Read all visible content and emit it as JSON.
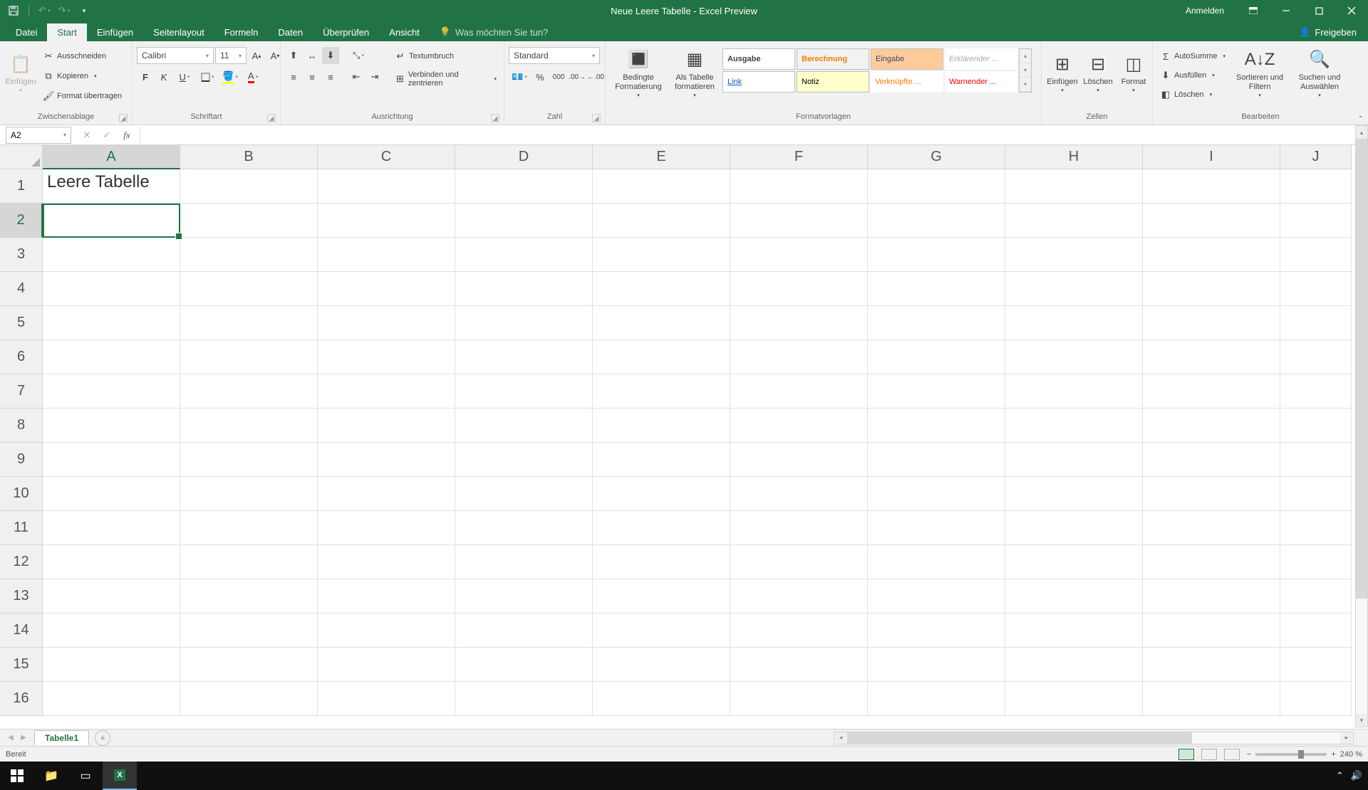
{
  "titlebar": {
    "title": "Neue Leere Tabelle  -  Excel Preview",
    "signin": "Anmelden"
  },
  "menu": {
    "tabs": [
      "Datei",
      "Start",
      "Einfügen",
      "Seitenlayout",
      "Formeln",
      "Daten",
      "Überprüfen",
      "Ansicht"
    ],
    "active": 1,
    "tellme": "Was möchten Sie tun?",
    "share": "Freigeben"
  },
  "ribbon": {
    "clipboard": {
      "paste": "Einfügen",
      "cut": "Ausschneiden",
      "copy": "Kopieren",
      "painter": "Format übertragen",
      "label": "Zwischenablage"
    },
    "font": {
      "name": "Calibri",
      "size": "11",
      "label": "Schriftart"
    },
    "align": {
      "wrap": "Textumbruch",
      "merge": "Verbinden und zentrieren",
      "label": "Ausrichtung"
    },
    "number": {
      "format": "Standard",
      "label": "Zahl"
    },
    "styles": {
      "cond": "Bedingte Formatierung",
      "astable": "Als Tabelle formatieren",
      "cells": [
        "Ausgabe",
        "Berechnung",
        "Eingabe",
        "Erklärender ...",
        "Link",
        "Notiz",
        "Verknüpfte ...",
        "Warnender ..."
      ],
      "label": "Formatvorlagen"
    },
    "cells": {
      "insert": "Einfügen",
      "delete": "Löschen",
      "format": "Format",
      "label": "Zellen"
    },
    "editing": {
      "autosum": "AutoSumme",
      "fill": "Ausfüllen",
      "clear": "Löschen",
      "sort": "Sortieren und Filtern",
      "find": "Suchen und Auswählen",
      "label": "Bearbeiten"
    }
  },
  "fbar": {
    "namebox": "A2",
    "formula": ""
  },
  "grid": {
    "cols": [
      "A",
      "B",
      "C",
      "D",
      "E",
      "F",
      "G",
      "H",
      "I",
      "J"
    ],
    "rows": [
      "1",
      "2",
      "3",
      "4",
      "5",
      "6",
      "7",
      "8",
      "9",
      "10",
      "11",
      "12",
      "13",
      "14",
      "15",
      "16"
    ],
    "data": {
      "A1": "Leere Tabelle"
    },
    "selected": "A2"
  },
  "sheets": {
    "active": "Tabelle1"
  },
  "status": {
    "ready": "Bereit",
    "zoom": "240 %"
  }
}
